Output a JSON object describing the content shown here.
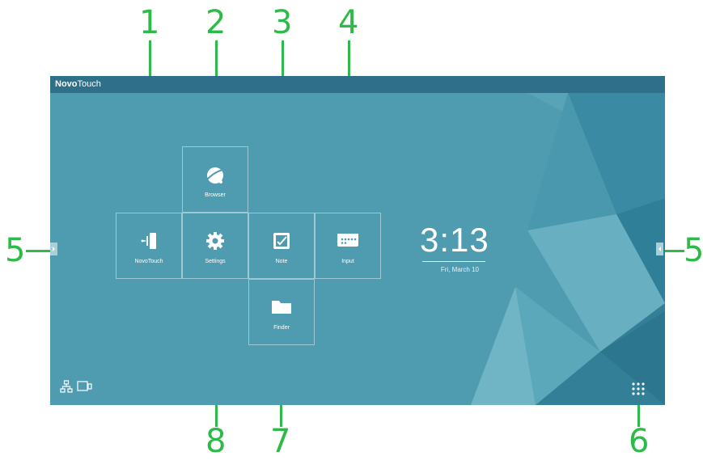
{
  "app": {
    "brand_bold": "Novo",
    "brand_light": "Touch"
  },
  "tiles": {
    "browser": {
      "label": "Browser",
      "icon": "globe-icon"
    },
    "novotouch": {
      "label": "NovoTouch",
      "icon": "novotouch-icon"
    },
    "settings": {
      "label": "Settings",
      "icon": "gear-icon"
    },
    "note": {
      "label": "Note",
      "icon": "note-icon"
    },
    "input": {
      "label": "Input",
      "icon": "input-source-icon"
    },
    "finder": {
      "label": "Finder",
      "icon": "folder-icon"
    }
  },
  "clock": {
    "time": "3:13",
    "date": "Fri, March 10"
  },
  "bottom_left_icons": [
    "network-icon",
    "screen-share-icon"
  ],
  "bottom_right_icon": "app-grid-icon",
  "callouts": {
    "n1": "1",
    "n2": "2",
    "n3": "3",
    "n4": "4",
    "n5_left": "5",
    "n5_right": "5",
    "n6": "6",
    "n7": "7",
    "n8": "8"
  },
  "colors": {
    "screen_bg": "#4f9bb0",
    "topbar": "#2f6f89",
    "callout": "#2dba49"
  }
}
